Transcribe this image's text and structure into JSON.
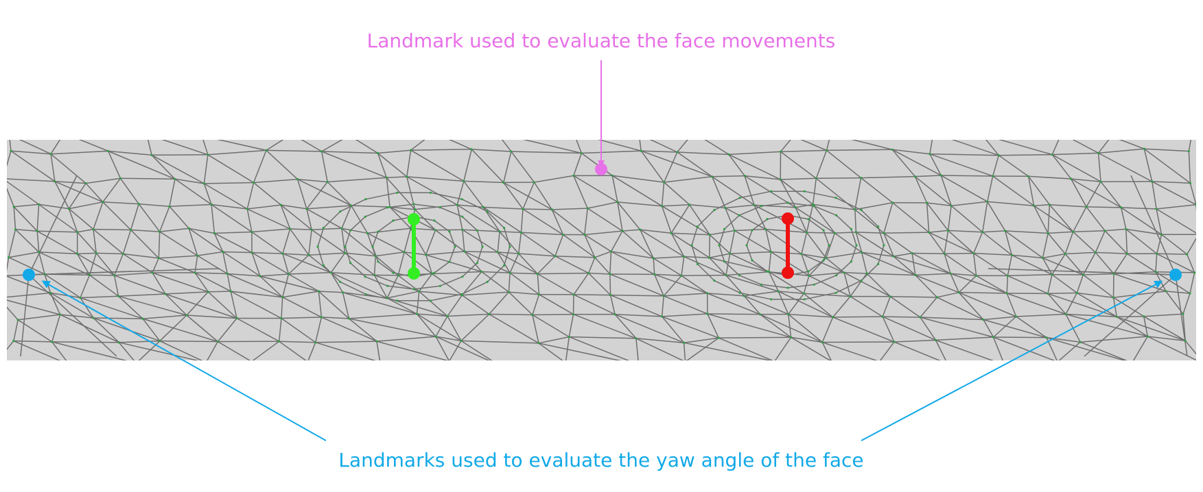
{
  "annotations": {
    "movement_label": "Landmark used to evaluate the face movements",
    "yaw_label": "Landmarks used to evaluate the yaw angle of the face"
  },
  "colors": {
    "background": "#ffffff",
    "mesh_background": "#d3d3d3",
    "mesh_lines": "#6e6e6e",
    "movement": "#e870e8",
    "yaw": "#12a9e8",
    "left_eye": "#33ee22",
    "right_eye": "#ee1111",
    "vertex_id": "#e03c3c"
  },
  "icons": {
    "movement_landmark": "magenta-dot-icon",
    "yaw_landmarks": "blue-dot-icon",
    "left_eye_landmarks": "green-dot-icon",
    "right_eye_landmarks": "red-dot-icon"
  }
}
